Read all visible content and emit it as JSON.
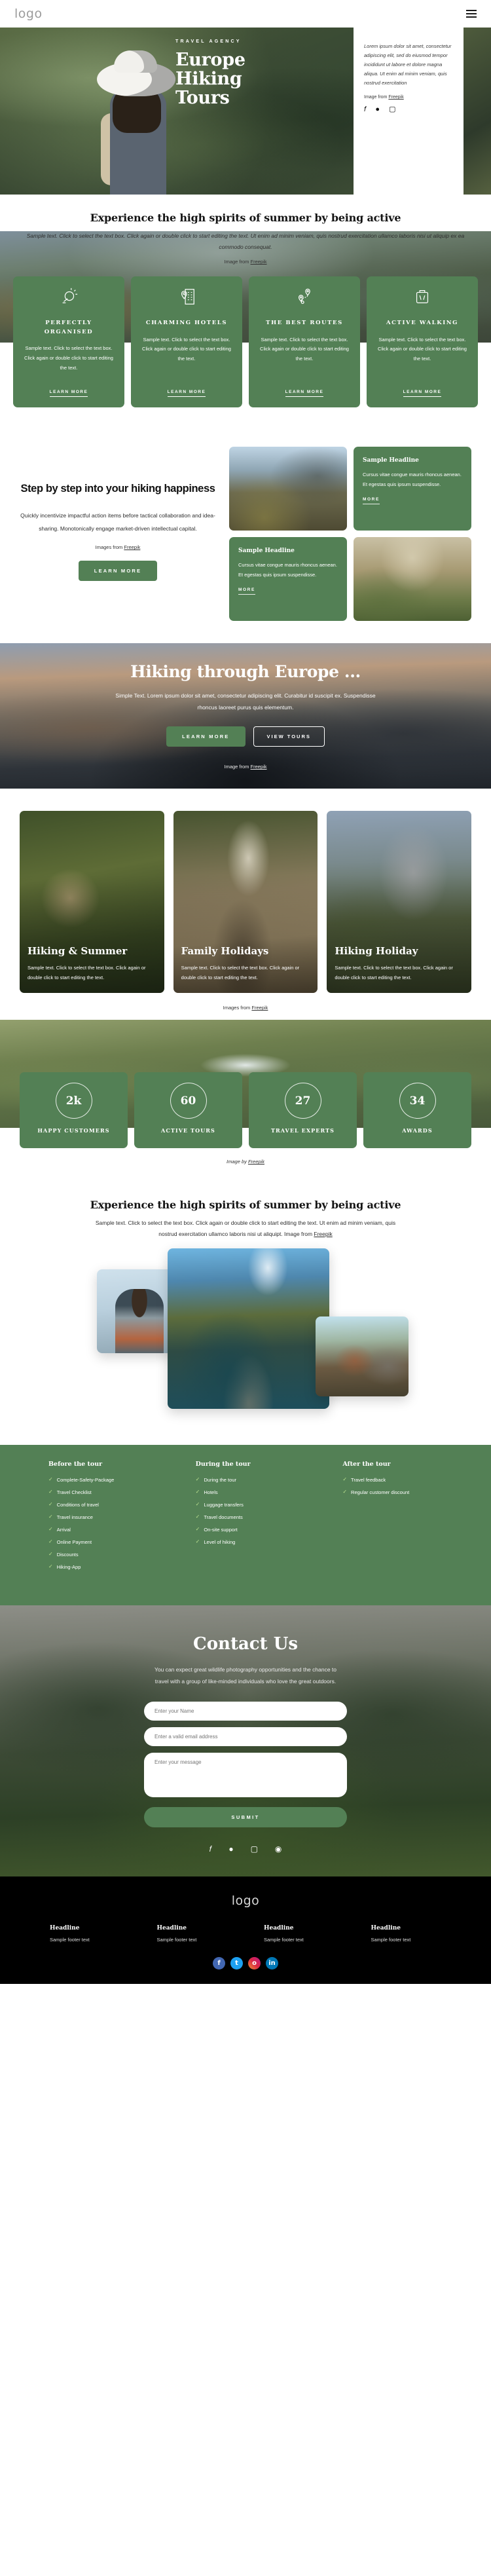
{
  "header": {
    "logo": "logo",
    "menu_icon": "hamburger-menu"
  },
  "hero": {
    "kicker": "TRAVEL AGENCY",
    "title_lines": [
      "Europe",
      "Hiking",
      "Tours"
    ],
    "paragraph": "Lorem ipsum dolor sit amet, consectetur adipiscing elit, sed do eiusmod tempor incididunt ut labore et dolore magna aliqua. Ut enim ad minim veniam, quis nostrud exercitation",
    "credit_prefix": "Image from ",
    "credit_link": "Freepik",
    "socials": [
      "facebook-icon",
      "twitter-icon",
      "instagram-icon"
    ]
  },
  "features_intro": {
    "title": "Experience the high spirits of summer by being active",
    "paragraph": "Sample text. Click to select the text box. Click again or double click to start editing the text. Ut enim ad minim veniam, quis nostrud exercitation ullamco laboris nisi ut aliquip ex ea commodo consequat.",
    "credit_prefix": "Image from ",
    "credit_link": "Freepik"
  },
  "features": [
    {
      "icon": "compass-icon",
      "title": "PERFECTLY ORGANISED",
      "text": "Sample text. Click to select the text box. Click again or double click to start editing the text.",
      "cta": "LEARN MORE"
    },
    {
      "icon": "hotel-icon",
      "title": "CHARMING HOTELS",
      "text": "Sample text. Click to select the text box. Click again or double click to start editing the text.",
      "cta": "LEARN MORE"
    },
    {
      "icon": "route-icon",
      "title": "THE BEST ROUTES",
      "text": "Sample text. Click to select the text box. Click again or double click to start editing the text.",
      "cta": "LEARN MORE"
    },
    {
      "icon": "suitcase-icon",
      "title": "ACTIVE WALKING",
      "text": "Sample text. Click to select the text box. Click again or double click to start editing the text.",
      "cta": "LEARN MORE"
    }
  ],
  "step": {
    "title": "Step by step into your hiking happiness",
    "paragraph": "Quickly incentivize impactful action items before tactical collaboration and idea-sharing. Monotonically engage market-driven intellectual capital.",
    "credit_prefix": "Images from ",
    "credit_link": "Freepik",
    "cta": "LEARN MORE",
    "tiles": [
      {
        "type": "image",
        "alt": "hiker-on-mountain-ridge-photo"
      },
      {
        "type": "card",
        "headline": "Sample Headline",
        "text": "Cursus vitae congue mauris rhoncus aenean. Et egestas quis ipsum suspendisse.",
        "cta": "MORE"
      },
      {
        "type": "card",
        "headline": "Sample Headline",
        "text": "Cursus vitae congue mauris rhoncus aenean. Et egestas quis ipsum suspendisse.",
        "cta": "MORE"
      },
      {
        "type": "image",
        "alt": "two-women-in-tent-photo"
      }
    ]
  },
  "banner": {
    "title": "Hiking through Europe ...",
    "paragraph": "Simple Text. Lorem ipsum dolor sit amet, consectetur adipiscing elit. Curabitur id suscipit ex. Suspendisse rhoncus laoreet purus quis elementum.",
    "primary_cta": "LEARN MORE",
    "secondary_cta": "VIEW TOURS",
    "credit_prefix": "Image from ",
    "credit_link": "Freepik"
  },
  "tours": {
    "cards": [
      {
        "title": "Hiking & Summer",
        "text": "Sample text. Click to select the text box. Click again or double click to start editing the text."
      },
      {
        "title": "Family Holidays",
        "text": "Sample text. Click to select the text box. Click again or double click to start editing the text."
      },
      {
        "title": "Hiking Holiday",
        "text": "Sample text. Click to select the text box. Click again or double click to start editing the text."
      }
    ],
    "credit_prefix": "Images from ",
    "credit_link": "Freepik"
  },
  "stats": {
    "items": [
      {
        "value": "2k",
        "label": "HAPPY CUSTOMERS"
      },
      {
        "value": "60",
        "label": "ACTIVE TOURS"
      },
      {
        "value": "27",
        "label": "TRAVEL EXPERTS"
      },
      {
        "value": "34",
        "label": "AWARDS"
      }
    ],
    "credit_prefix": "Image by ",
    "credit_link": "Freepik"
  },
  "gallery_intro": {
    "title": "Experience the high spirits of summer by being active",
    "paragraph": "Sample text. Click to select the text box. Click again or double click to start editing the text. Ut enim ad minim veniam, quis nostrud exercitation ullamco laboris nisi ut aliquipt. Image from ",
    "credit_link": "Freepik"
  },
  "gallery": {
    "images": [
      {
        "alt": "hiker-with-backpack-photo"
      },
      {
        "alt": "mountain-lake-reflection-photo"
      },
      {
        "alt": "pine-trees-valley-photo"
      }
    ]
  },
  "green_links": {
    "columns": [
      {
        "heading": "Before the tour",
        "items": [
          "Complete-Safety-Package",
          "Travel Checklist",
          "Conditions of travel",
          "Travel insurance",
          "Arrival",
          "Online Payment",
          "Discounts",
          "Hiking-App"
        ]
      },
      {
        "heading": "During the tour",
        "items": [
          "During the tour",
          "Hotels",
          "Luggage transfers",
          "Travel documents",
          "On-site support",
          "Level of hiking"
        ]
      },
      {
        "heading": "After the tour",
        "items": [
          "Travel feedback",
          "Regular customer discount"
        ]
      }
    ],
    "check_color": "#b9e08f"
  },
  "contact": {
    "title": "Contact Us",
    "paragraph": "You can expect great wildlife photography opportunities and the chance to travel with a group of like-minded individuals who love the great outdoors.",
    "name_placeholder": "Enter your Name",
    "email_placeholder": "Enter a valid email address",
    "message_placeholder": "Enter your message",
    "submit": "SUBMIT",
    "socials": [
      "facebook-icon",
      "twitter-icon",
      "instagram-icon",
      "dribbble-icon"
    ]
  },
  "footer": {
    "logo": "logo",
    "columns": [
      {
        "heading": "Headline",
        "text": "Sample footer text"
      },
      {
        "heading": "Headline",
        "text": "Sample footer text"
      },
      {
        "heading": "Headline",
        "text": "Sample footer text"
      },
      {
        "heading": "Headline",
        "text": "Sample footer text"
      }
    ],
    "socials": [
      {
        "name": "facebook-icon",
        "glyph": "f",
        "color": "#4267b2"
      },
      {
        "name": "twitter-icon",
        "glyph": "t",
        "color": "#1da1f2"
      },
      {
        "name": "instagram-icon",
        "glyph": "o",
        "color": "#bc1888"
      },
      {
        "name": "linkedin-icon",
        "glyph": "in",
        "color": "#0077b5"
      }
    ]
  },
  "theme": {
    "green": "#538055",
    "dark": "#000000"
  }
}
